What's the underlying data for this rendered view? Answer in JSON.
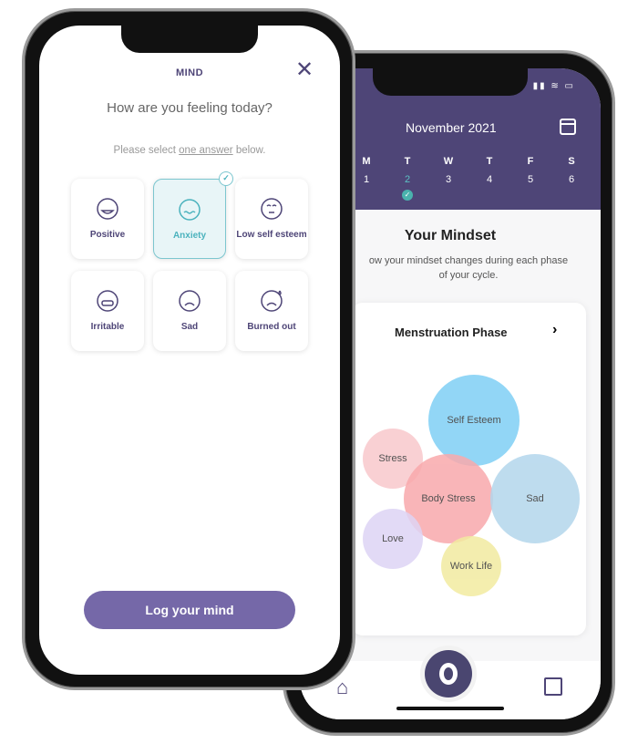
{
  "mind_screen": {
    "title": "MIND",
    "question": "How are you feeling today?",
    "instruction_prefix": "Please select ",
    "instruction_link": "one answer",
    "instruction_suffix": " below.",
    "options": [
      {
        "label": "Positive",
        "icon": "smile-face-icon",
        "selected": false
      },
      {
        "label": "Anxiety",
        "icon": "anxious-face-icon",
        "selected": true
      },
      {
        "label": "Low self esteem",
        "icon": "low-face-icon",
        "selected": false
      },
      {
        "label": "Irritable",
        "icon": "gritted-teeth-face-icon",
        "selected": false
      },
      {
        "label": "Sad",
        "icon": "sad-face-icon",
        "selected": false
      },
      {
        "label": "Burned out",
        "icon": "sweat-face-icon",
        "selected": false
      }
    ],
    "submit_label": "Log your mind",
    "accent": "#7568a8"
  },
  "mindset_screen": {
    "month": "November 2021",
    "days": [
      {
        "letter": "M",
        "num": "1"
      },
      {
        "letter": "T",
        "num": "2",
        "selected": true
      },
      {
        "letter": "W",
        "num": "3"
      },
      {
        "letter": "T",
        "num": "4"
      },
      {
        "letter": "F",
        "num": "5"
      },
      {
        "letter": "S",
        "num": "6"
      }
    ],
    "heading": "Your Mindset",
    "subtitle_line1": "ow your mindset changes during each phase",
    "subtitle_line2": "of your cycle.",
    "phase": "Menstruation Phase",
    "bubbles": [
      {
        "label": "Self Esteem",
        "color": "#7fd0f5"
      },
      {
        "label": "Stress",
        "color": "#f8c8cc"
      },
      {
        "label": "Body Stress",
        "color": "#f9a9ac"
      },
      {
        "label": "Sad",
        "color": "#b3d6ec"
      },
      {
        "label": "Love",
        "color": "#ded4f5"
      },
      {
        "label": "Work Life",
        "color": "#f2eba0"
      }
    ],
    "header_color": "#4e4577"
  }
}
